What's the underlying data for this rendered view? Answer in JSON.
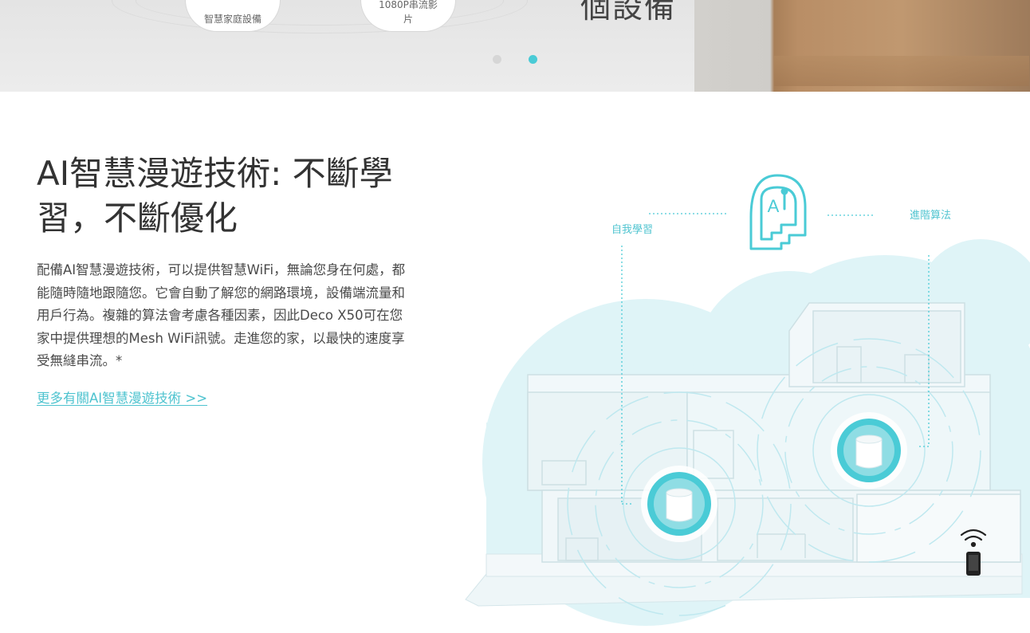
{
  "carousel": {
    "bubble_1_text": "智慧家庭設備",
    "bubble_2_text": "1080P串流影片",
    "heading_fragment": "個設備",
    "dots": 2,
    "active_dot": 2
  },
  "section": {
    "title": "AI智慧漫遊技術: 不斷學習，不斷優化",
    "body": "配備AI智慧漫遊技術，可以提供智慧WiFi，無論您身在何處，都能隨時隨地跟隨您。它會自動了解您的網路環境，設備端流量和用戶行為。複雜的算法會考慮各種因素，因此Deco X50可在您家中提供理想的Mesh WiFi訊號。走進您的家，以最快的速度享受無縫串流。*",
    "link_text": "更多有關AI智慧漫遊技術 >>"
  },
  "illustration": {
    "label_left": "自我學習",
    "label_right": "進階算法",
    "ai_icon_text": "A",
    "icons": [
      "ai-head-icon",
      "deco-router-icon",
      "wifi-icon",
      "smartphone-icon"
    ]
  },
  "colors": {
    "accent": "#4acbd6",
    "link": "#4ec3cf",
    "text": "#333333",
    "cloud": "#dff4f7"
  }
}
